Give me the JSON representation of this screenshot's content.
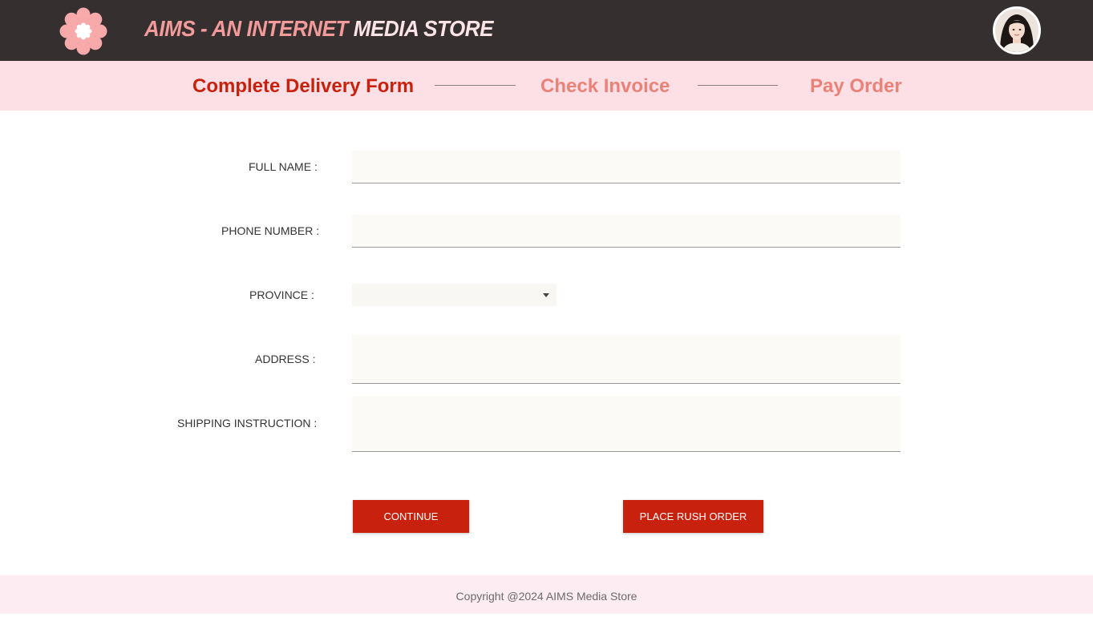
{
  "header": {
    "title_part1": "AIMS - AN INTERNET ",
    "title_part2": "MEDIA STORE",
    "logo_icon": "pink-flower-icon",
    "avatar_icon": "user-avatar-photo"
  },
  "steps": [
    {
      "label": "Complete Delivery Form",
      "state": "active"
    },
    {
      "label": "Check Invoice",
      "state": "pending"
    },
    {
      "label": "Pay Order",
      "state": "pending"
    }
  ],
  "form": {
    "full_name": {
      "label": "FULL NAME :",
      "value": ""
    },
    "phone_number": {
      "label": "PHONE NUMBER :",
      "value": ""
    },
    "province": {
      "label": "PROVINCE :",
      "value": ""
    },
    "address": {
      "label": "ADDRESS :",
      "value": ""
    },
    "shipping_instruction": {
      "label": "SHIPPING INSTRUCTION :",
      "value": ""
    }
  },
  "buttons": {
    "continue_label": "CONTINUE",
    "rush_order_label": "PLACE RUSH ORDER"
  },
  "footer": {
    "copyright": "Copyright @2024 AIMS Media Store"
  },
  "colors": {
    "header_bg": "#352f30",
    "accent_red": "#c8210d",
    "step_inactive": "#eb8278",
    "steps_bg": "#fde0e6",
    "footer_bg": "#fdecf1"
  }
}
